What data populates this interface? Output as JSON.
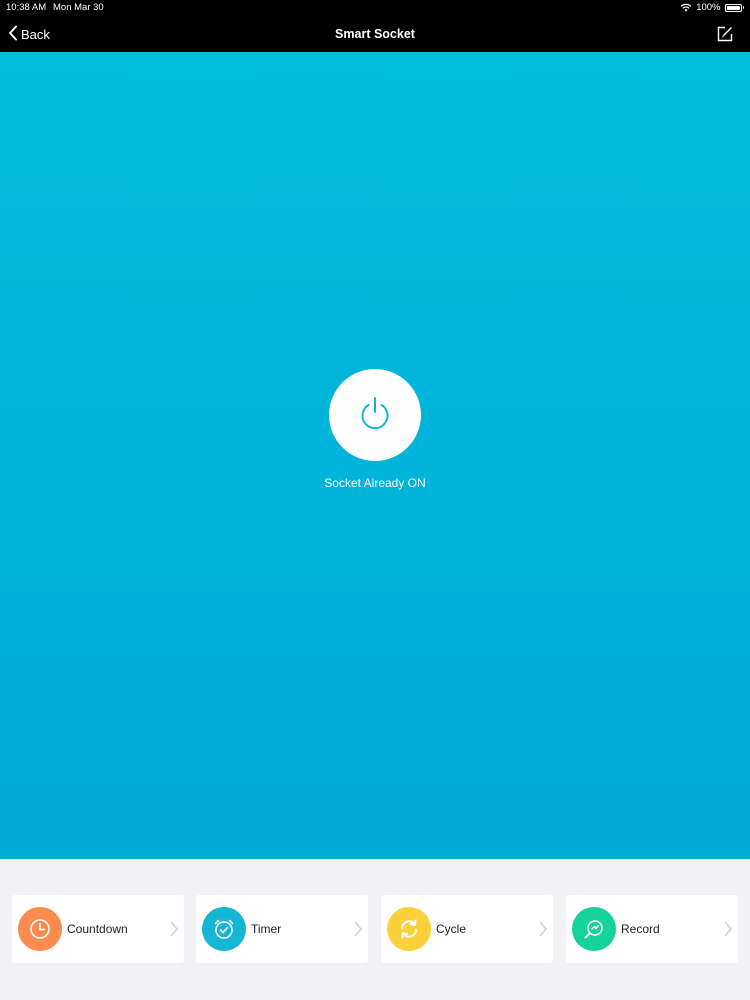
{
  "status_bar": {
    "time": "10:38 AM",
    "date": "Mon Mar 30",
    "battery": "100%"
  },
  "nav": {
    "back_label": "Back",
    "title": "Smart Socket"
  },
  "socket": {
    "status_text": "Socket Already ON"
  },
  "features": [
    {
      "label": "Countdown",
      "icon": "clock-icon",
      "color": "#fb8c4e"
    },
    {
      "label": "Timer",
      "icon": "alarm-clock-icon",
      "color": "#14b6d4"
    },
    {
      "label": "Cycle",
      "icon": "cycle-arrows-icon",
      "color": "#fbd13b"
    },
    {
      "label": "Record",
      "icon": "record-search-icon",
      "color": "#14d29a"
    }
  ],
  "colors": {
    "accent": "#00b3d9",
    "background": "#f2f1f6"
  }
}
